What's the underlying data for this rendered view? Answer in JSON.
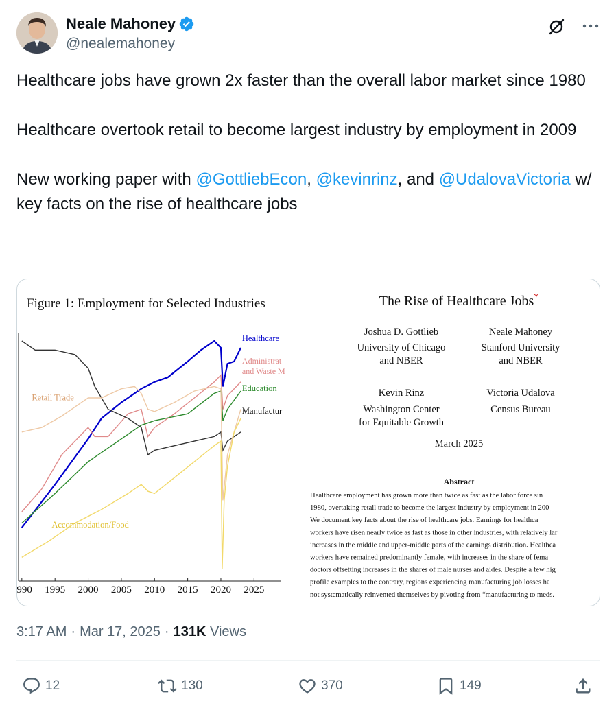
{
  "author": {
    "name": "Neale Mahoney",
    "handle": "@nealemahoney"
  },
  "tweet": {
    "para1": "Healthcare jobs have grown 2x faster than the overall labor market since 1980",
    "para2": "Healthcare overtook retail to become largest industry by employment in 2009",
    "para3_prefix": "New working paper with ",
    "mention1": "@GottliebEcon",
    "sep1": ", ",
    "mention2": "@kevinrinz",
    "sep2": ", and ",
    "mention3": "@UdalovaVictoria",
    "para3_suffix": " w/ key facts on the rise of healthcare jobs"
  },
  "image": {
    "figure_title": "Figure 1:  Employment for Selected Industries",
    "paper_title": "The Rise of Healthcare Jobs",
    "asterisk": "*",
    "authors": [
      {
        "name": "Joshua D. Gottlieb",
        "aff1": "University of Chicago",
        "aff2": "and NBER"
      },
      {
        "name": "Neale Mahoney",
        "aff1": "Stanford University",
        "aff2": "and NBER"
      },
      {
        "name": "Kevin Rinz",
        "aff1": "Washington Center",
        "aff2": "for Equitable Growth"
      },
      {
        "name": "Victoria Udalova",
        "aff1": "Census Bureau",
        "aff2": ""
      }
    ],
    "date": "March 2025",
    "abstract_heading": "Abstract",
    "abstract_lines": [
      "Healthcare employment has grown more than twice as fast as the labor force sin",
      "1980, overtaking retail trade to become the largest industry by employment in 200",
      "We document key facts about the rise of healthcare jobs.  Earnings for healthca",
      "workers have risen nearly twice as fast as those in other industries, with relatively lar",
      "increases in the middle and upper-middle parts of the earnings distribution.  Healthca",
      "workers have remained predominantly female, with increases in the share of fema",
      "doctors offsetting increases in the shares of male nurses and aides.  Despite a few hig",
      "profile examples to the contrary, regions experiencing manufacturing job losses ha",
      "not systematically reinvented themselves by pivoting from “manufacturing to meds."
    ]
  },
  "chart_data": {
    "type": "line",
    "title": "Figure 1:  Employment for Selected Industries",
    "xlabel": "",
    "ylabel": "",
    "xlim": [
      1989.5,
      2026
    ],
    "ylim": [
      0,
      100
    ],
    "x_ticks": [
      "1990",
      "1995",
      "2000",
      "2005",
      "2010",
      "2015",
      "2020",
      "2025"
    ],
    "series": [
      {
        "name": "Healthcare",
        "color": "#0000cc",
        "x": [
          1990,
          1995,
          2000,
          2002,
          2005,
          2008,
          2010,
          2012,
          2015,
          2017,
          2019,
          2020,
          2020.3,
          2021,
          2022,
          2023
        ],
        "y": [
          18,
          37,
          57,
          66,
          73,
          79,
          82,
          84,
          91,
          96,
          100,
          97,
          80,
          90,
          91,
          97
        ]
      },
      {
        "name": "Administrat and Waste M",
        "color": "#e08a8a",
        "x": [
          1990,
          1993,
          1996,
          2000,
          2001,
          2003,
          2006,
          2008,
          2009,
          2010,
          2013,
          2016,
          2019,
          2020,
          2020.3,
          2021,
          2023
        ],
        "y": [
          25,
          35,
          50,
          62,
          58,
          58,
          68,
          70,
          58,
          62,
          68,
          75,
          82,
          85,
          70,
          76,
          82
        ]
      },
      {
        "name": "Education",
        "color": "#2e8b2e",
        "x": [
          1990,
          1995,
          2000,
          2005,
          2008,
          2010,
          2015,
          2019,
          2020,
          2020.3,
          2021,
          2023
        ],
        "y": [
          20,
          33,
          47,
          57,
          63,
          65,
          68,
          77,
          78,
          65,
          70,
          78
        ]
      },
      {
        "name": "Manufactur",
        "color": "#333333",
        "x": [
          1990,
          1992,
          1995,
          1998,
          2000,
          2001,
          2003,
          2006,
          2008,
          2009,
          2010,
          2013,
          2016,
          2019,
          2020,
          2020.3,
          2021,
          2023
        ],
        "y": [
          100,
          96,
          96,
          94,
          88,
          80,
          70,
          66,
          62,
          50,
          52,
          54,
          56,
          58,
          60,
          52,
          56,
          60
        ]
      },
      {
        "name": "Retail Trade",
        "color": "#eec9a6",
        "x": [
          1990,
          1993,
          1996,
          1999,
          2000,
          2002,
          2005,
          2007,
          2008,
          2009,
          2010,
          2013,
          2016,
          2019,
          2020,
          2020.3,
          2021,
          2023
        ],
        "y": [
          60,
          62,
          67,
          73,
          75,
          75,
          79,
          80,
          77,
          70,
          69,
          73,
          78,
          80,
          79,
          30,
          50,
          70
        ]
      },
      {
        "name": "Accommodation/Food",
        "color": "#f2d96a",
        "x": [
          1990,
          1994,
          1998,
          2002,
          2006,
          2008,
          2009,
          2010,
          2013,
          2016,
          2019,
          2020,
          2020.2,
          2020.5,
          2021,
          2022,
          2023
        ],
        "y": [
          5,
          12,
          20,
          26,
          33,
          37,
          34,
          33,
          40,
          47,
          54,
          56,
          0,
          30,
          45,
          60,
          66
        ]
      }
    ]
  },
  "meta": {
    "time": "3:17 AM",
    "dot1": "·",
    "date": "Mar 17, 2025",
    "dot2": "·",
    "views_count": "131K",
    "views_label": "Views"
  },
  "actions": {
    "replies": "12",
    "reposts": "130",
    "likes": "370",
    "bookmarks": "149"
  },
  "colors": {
    "link": "#1d9bf0",
    "secondary_text": "#536471",
    "verified": "#1d9bf0"
  }
}
